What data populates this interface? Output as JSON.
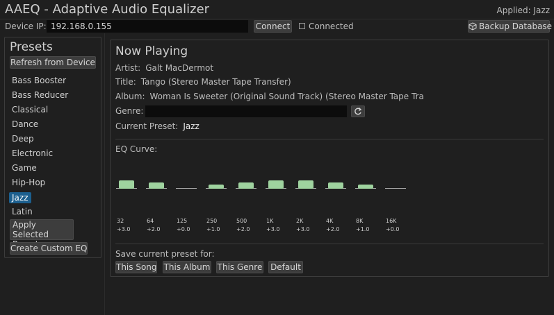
{
  "window": {
    "title": "AAEQ - Adaptive Audio Equalizer",
    "applied": "Applied: Jazz"
  },
  "device": {
    "label": "Device IP:",
    "ip": "192.168.0.155",
    "connect_label": "Connect",
    "connected_label": "Connected",
    "connected_checked": false,
    "backup_label": "Backup Database",
    "backup_icon": "package-icon"
  },
  "presets": {
    "title": "Presets",
    "refresh_label": "Refresh from Device",
    "items": [
      "Bass Booster",
      "Bass Reducer",
      "Classical",
      "Dance",
      "Deep",
      "Electronic",
      "Game",
      "Hip-Hop",
      "Jazz",
      "Latin"
    ],
    "selected": "Jazz",
    "apply_label": "Apply Selected Preset",
    "create_label": "Create Custom EQ"
  },
  "now_playing": {
    "title": "Now Playing",
    "artist_label": "Artist:",
    "artist": "Galt MacDermot",
    "title_label": "Title:",
    "song_title": "Tango (Stereo Master Tape Transfer)",
    "album_label": "Album:",
    "album": "Woman Is Sweeter (Original Sound Track) (Stereo Master Tape Tra",
    "genre_label": "Genre:",
    "genre_value": "",
    "genre_refresh_icon": "refresh-icon",
    "current_preset_label": "Current Preset:",
    "current_preset": "Jazz"
  },
  "eq": {
    "label": "EQ Curve:",
    "bar_color": "#9fd39f",
    "bands": [
      {
        "freq": "32",
        "gain": "+3.0",
        "value": 3.0
      },
      {
        "freq": "64",
        "gain": "+2.0",
        "value": 2.0
      },
      {
        "freq": "125",
        "gain": "+0.0",
        "value": 0.0
      },
      {
        "freq": "250",
        "gain": "+1.0",
        "value": 1.0
      },
      {
        "freq": "500",
        "gain": "+2.0",
        "value": 2.0
      },
      {
        "freq": "1K",
        "gain": "+3.0",
        "value": 3.0
      },
      {
        "freq": "2K",
        "gain": "+3.0",
        "value": 3.0
      },
      {
        "freq": "4K",
        "gain": "+2.0",
        "value": 2.0
      },
      {
        "freq": "8K",
        "gain": "+1.0",
        "value": 1.0
      },
      {
        "freq": "16K",
        "gain": "+0.0",
        "value": 0.0
      }
    ]
  },
  "save": {
    "label": "Save current preset for:",
    "buttons": [
      "This Song",
      "This Album",
      "This Genre",
      "Default"
    ]
  }
}
